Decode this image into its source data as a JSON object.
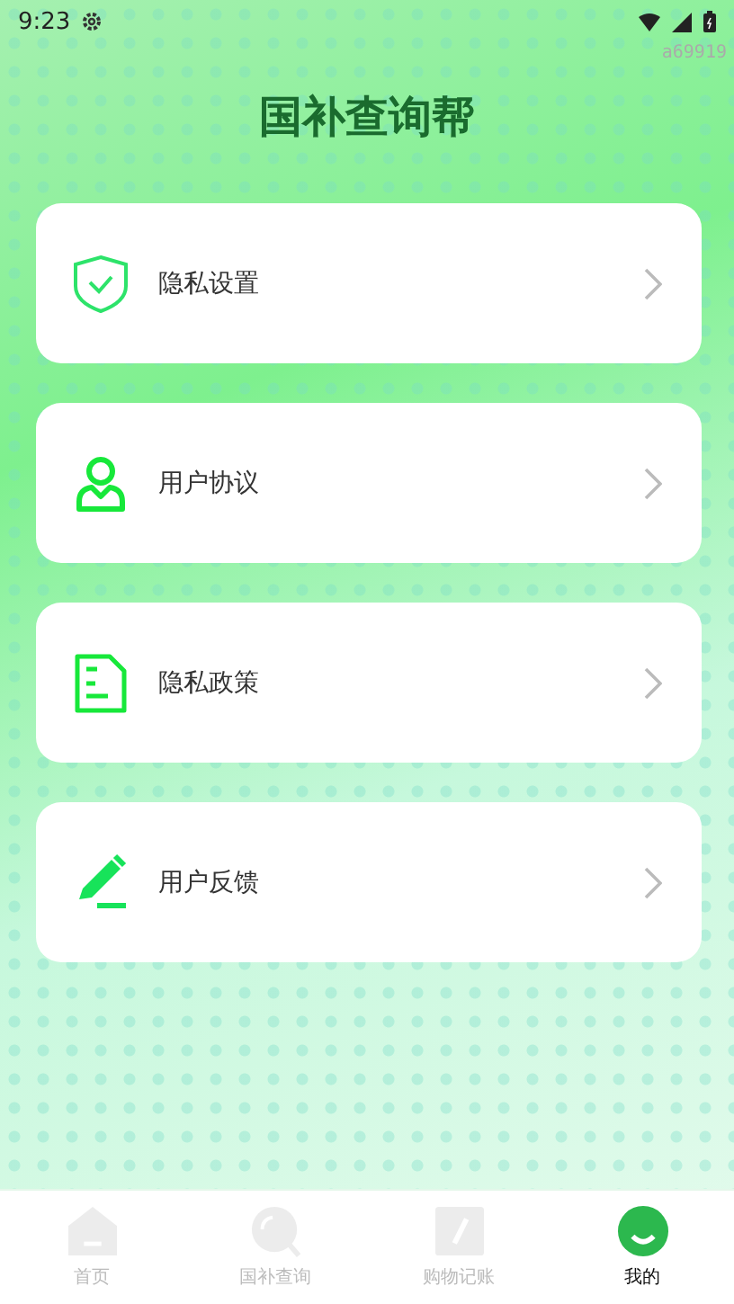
{
  "status_bar": {
    "time": "9:23",
    "tag": "a69919"
  },
  "title": "国补查询帮",
  "menu_items": [
    {
      "kind": "shield",
      "label": "隐私设置"
    },
    {
      "kind": "person",
      "label": "用户协议"
    },
    {
      "kind": "document",
      "label": "隐私政策"
    },
    {
      "kind": "pencil",
      "label": "用户反馈"
    }
  ],
  "tab_bar": [
    {
      "kind": "home",
      "label": "首页",
      "selected": false
    },
    {
      "kind": "search",
      "label": "国补查询",
      "selected": false
    },
    {
      "kind": "note",
      "label": "购物记账",
      "selected": false
    },
    {
      "kind": "smile",
      "label": "我的",
      "selected": true
    }
  ]
}
